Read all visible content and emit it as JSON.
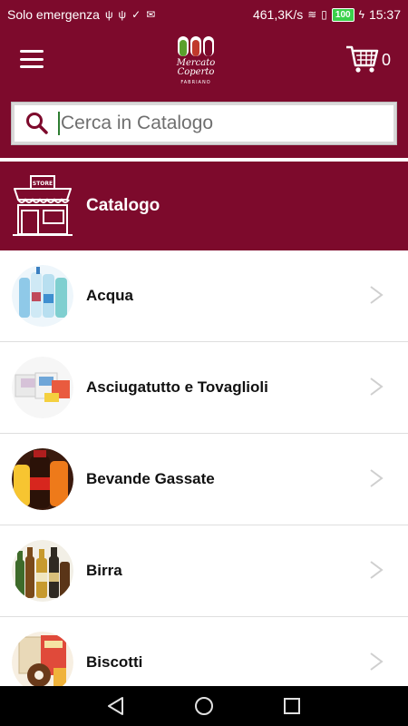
{
  "status_bar": {
    "carrier": "Solo emergenza",
    "network_speed": "461,3K/s",
    "battery": "100",
    "time": "15:37"
  },
  "header": {
    "logo_text_line1": "Mercato",
    "logo_text_line2": "Coperto",
    "logo_sub": "FABRIANO",
    "cart_count": "0"
  },
  "search": {
    "placeholder": "Cerca in Catalogo",
    "value": ""
  },
  "catalog": {
    "title": "Catalogo",
    "store_sign": "STORE"
  },
  "categories": [
    {
      "label": "Acqua",
      "icon": "water-bottles-icon"
    },
    {
      "label": "Asciugatutto e Tovaglioli",
      "icon": "paper-towels-icon"
    },
    {
      "label": "Bevande Gassate",
      "icon": "soda-bottles-icon"
    },
    {
      "label": "Birra",
      "icon": "beer-bottles-icon"
    },
    {
      "label": "Biscotti",
      "icon": "biscuits-icon"
    }
  ],
  "colors": {
    "brand": "#7d0a2c",
    "chevron": "#cfcfcf"
  }
}
